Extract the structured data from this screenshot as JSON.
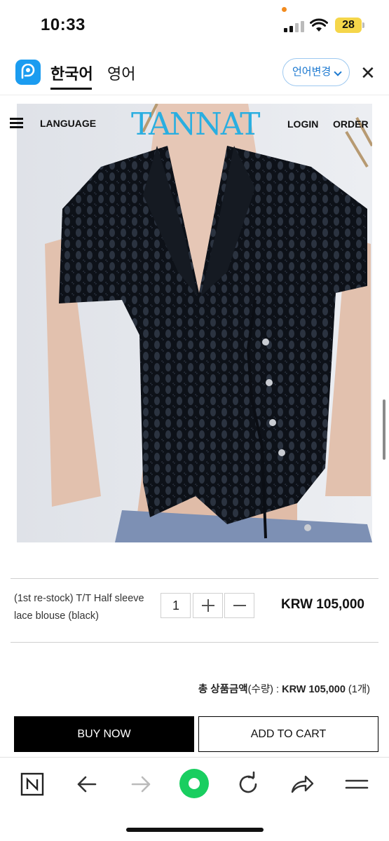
{
  "status_bar": {
    "time": "10:33",
    "battery": "28",
    "battery_color": "#f5d64a"
  },
  "translator": {
    "tabs": [
      "한국어",
      "영어"
    ],
    "active_tab": "한국어",
    "change_language_label": "언어변경",
    "close_icon": "close-icon",
    "accent": "#1b9cf0"
  },
  "site_nav": {
    "menu_icon": "hamburger-icon",
    "language_label": "LANGUAGE",
    "brand": "TANNAT",
    "login_label": "LOGIN",
    "order_label": "ORDER",
    "brand_color": "#2aaee0"
  },
  "product_option": {
    "name": "(1st re-stock) T/T Half sleeve lace blouse (black)",
    "quantity": "1",
    "plus_icon": "plus-icon",
    "minus_icon": "minus-icon",
    "price": "KRW 105,000"
  },
  "total": {
    "label": "총 상품금액",
    "qty_label": "(수량) : ",
    "amount": "KRW 105,000",
    "count": " (1개)"
  },
  "actions": {
    "buy_now": "BUY NOW",
    "add_to_cart": "ADD TO CART"
  },
  "browser_toolbar": {
    "icons": [
      "naver-n-icon",
      "back-arrow-icon",
      "forward-arrow-icon",
      "green-home-icon",
      "refresh-icon",
      "share-icon",
      "menu-icon"
    ],
    "green": "#19ce60"
  }
}
